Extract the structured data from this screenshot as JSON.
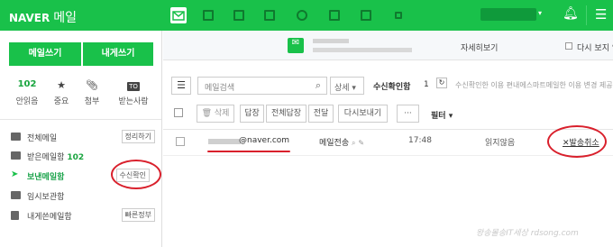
{
  "header": {
    "brand": "NAVER",
    "service": "메일",
    "apps": [
      {
        "icon": "mail-icon",
        "active": true
      },
      {
        "icon": "calendar-icon",
        "active": false
      },
      {
        "icon": "contacts-icon",
        "active": false
      },
      {
        "icon": "memo-icon",
        "active": false
      },
      {
        "icon": "cloud-icon",
        "active": false
      },
      {
        "icon": "photo-icon",
        "active": false
      },
      {
        "icon": "office-icon",
        "active": false
      },
      {
        "icon": "more-apps-icon",
        "active": false
      }
    ],
    "accent_color": "#19c14a"
  },
  "sidebar": {
    "compose_label": "메일쓰기",
    "self_mail_label": "내게쓰기",
    "quick": [
      {
        "value": "102",
        "icon": "",
        "label": "안읽음"
      },
      {
        "value": "",
        "icon": "star-icon",
        "label": "중요"
      },
      {
        "value": "",
        "icon": "clip-icon",
        "label": "첨부"
      },
      {
        "value": "",
        "icon": "TO",
        "label": "받는사람"
      }
    ],
    "folders": [
      {
        "label": "전체메일",
        "count": "",
        "action": "정리하기"
      },
      {
        "label": "받은메일함",
        "count": "102",
        "action": ""
      },
      {
        "label": "보낸메일함",
        "count": "",
        "action": "수신확인"
      },
      {
        "label": "임시보관함",
        "count": "",
        "action": ""
      },
      {
        "label": "내게쓴메일함",
        "count": "",
        "action": "빠른정부"
      }
    ]
  },
  "banner": {
    "more_label": "자세히보기",
    "no_show_label": "다시 보지 않"
  },
  "list_header": {
    "search_placeholder": "메일검색",
    "scope": "상세",
    "title": "수신확인함",
    "count": "1",
    "notice": "수신확인한 이용 편내에스마트메일한 이용 변경 제공"
  },
  "toolbar": {
    "delete": "삭제",
    "reply": "답장",
    "reply_all": "전체답장",
    "forward": "전달",
    "resend": "다시보내기",
    "more": "···",
    "filter": "필터"
  },
  "rows": [
    {
      "email": "@naver.com",
      "subject": "메일전송",
      "time": "17:48",
      "status": "읽지않음",
      "cancel": "발송취소"
    }
  ],
  "watermark": "왕송몰송IT세상 rdsong.com"
}
